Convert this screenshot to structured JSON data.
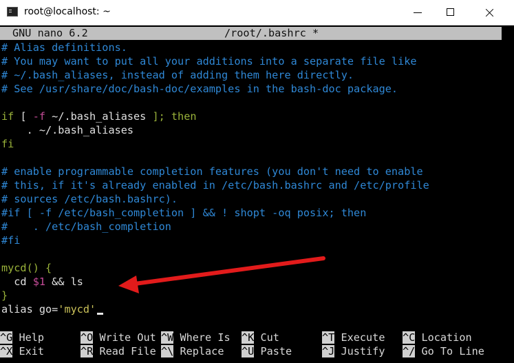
{
  "window": {
    "title": "root@localhost: ~"
  },
  "nano": {
    "version": "GNU nano 6.2",
    "file": "/root/.bashrc *"
  },
  "editor_lines": [
    {
      "text": "# Alias definitions.",
      "cls": "c-com"
    },
    {
      "text": "# You may want to put all your additions into a separate file like",
      "cls": "c-com"
    },
    {
      "text": "# ~/.bash_aliases, instead of adding them here directly.",
      "cls": "c-com"
    },
    {
      "text": "# See /usr/share/doc/bash-doc/examples in the bash-doc package.",
      "cls": "c-com"
    },
    {
      "text": "",
      "cls": ""
    },
    {
      "text": "",
      "cls": "",
      "segments": [
        [
          "if",
          "c-kw"
        ],
        [
          " [ ",
          "c-fg"
        ],
        [
          "-f",
          "c-var"
        ],
        [
          " ~/.bash_aliases ",
          "c-fg"
        ],
        [
          "]; then",
          "c-kw"
        ]
      ]
    },
    {
      "text": "    . ~/.bash_aliases",
      "cls": "c-fg"
    },
    {
      "text": "fi",
      "cls": "c-kw"
    },
    {
      "text": "",
      "cls": ""
    },
    {
      "text": "# enable programmable completion features (you don't need to enable",
      "cls": "c-com"
    },
    {
      "text": "# this, if it's already enabled in /etc/bash.bashrc and /etc/profile",
      "cls": "c-com"
    },
    {
      "text": "# sources /etc/bash.bashrc).",
      "cls": "c-com"
    },
    {
      "text": "#if [ -f /etc/bash_completion ] && ! shopt -oq posix; then",
      "cls": "c-com"
    },
    {
      "text": "#    . /etc/bash_completion",
      "cls": "c-com"
    },
    {
      "text": "#fi",
      "cls": "c-com"
    },
    {
      "text": "",
      "cls": ""
    },
    {
      "text": "",
      "cls": "",
      "segments": [
        [
          "mycd() {",
          "c-kw"
        ]
      ]
    },
    {
      "text": "",
      "cls": "",
      "segments": [
        [
          "  cd ",
          "c-fg"
        ],
        [
          "$1",
          "c-var"
        ],
        [
          " && ls",
          "c-fg"
        ]
      ]
    },
    {
      "text": "}",
      "cls": "c-kw"
    },
    {
      "text": "",
      "cls": "",
      "segments": [
        [
          "alias go=",
          "c-fg"
        ],
        [
          "'mycd'",
          "c-str"
        ]
      ],
      "cursor": true
    }
  ],
  "shortcuts": [
    {
      "key": "^G",
      "label": "Help"
    },
    {
      "key": "^O",
      "label": "Write Out"
    },
    {
      "key": "^W",
      "label": "Where Is"
    },
    {
      "key": "^K",
      "label": "Cut"
    },
    {
      "key": "^T",
      "label": "Execute"
    },
    {
      "key": "^C",
      "label": "Location"
    },
    {
      "key": "^X",
      "label": "Exit"
    },
    {
      "key": "^R",
      "label": "Read File"
    },
    {
      "key": "^\\",
      "label": "Replace"
    },
    {
      "key": "^U",
      "label": "Paste"
    },
    {
      "key": "^J",
      "label": "Justify"
    },
    {
      "key": "^/",
      "label": "Go To Line"
    }
  ],
  "colors": {
    "comment": "#2f88d6",
    "keyword": "#9ab33a",
    "variable": "#c54c98",
    "string": "#ccc35a",
    "annotation_arrow": "#e21b1b"
  },
  "icons": {
    "app": "terminal-icon",
    "minimize": "minimize-icon",
    "maximize": "maximize-icon",
    "close": "close-icon"
  }
}
